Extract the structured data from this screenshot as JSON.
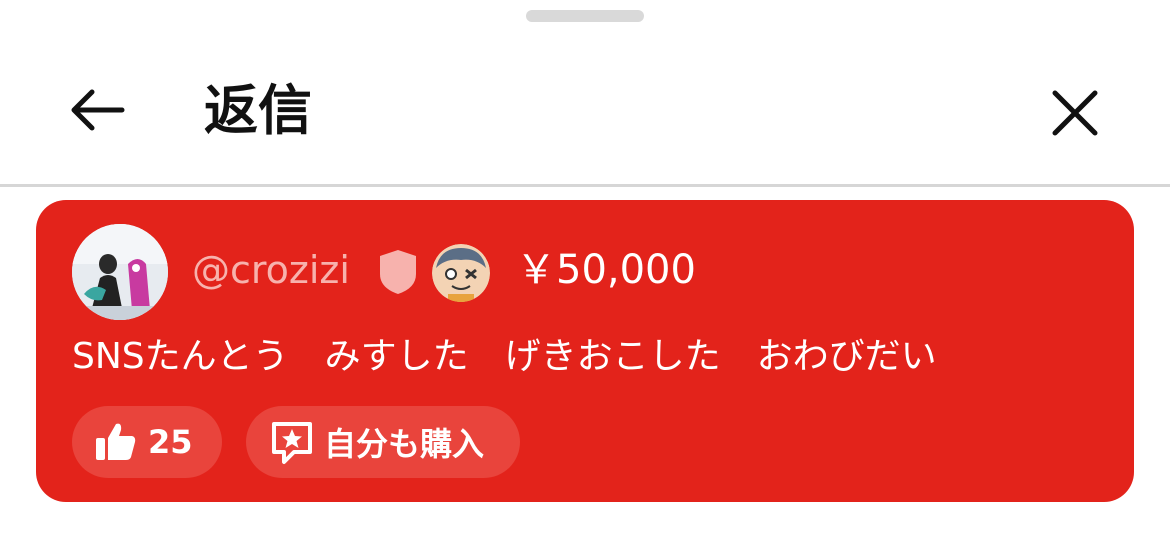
{
  "header": {
    "title": "返信",
    "back_icon": "arrow-left-icon",
    "close_icon": "close-icon"
  },
  "comment": {
    "username": "@crozizi",
    "badge_icon": "moderator-shield-icon",
    "sticker_icon": "character-sticker-icon",
    "amount": "￥50,000",
    "message": "SNSたんとう　みすした　げきおこした　おわびだい",
    "card_color": "#e3231b",
    "like": {
      "icon": "thumbs-up-icon",
      "count": "25"
    },
    "buy": {
      "icon": "star-chat-icon",
      "label": "自分も購入"
    }
  }
}
